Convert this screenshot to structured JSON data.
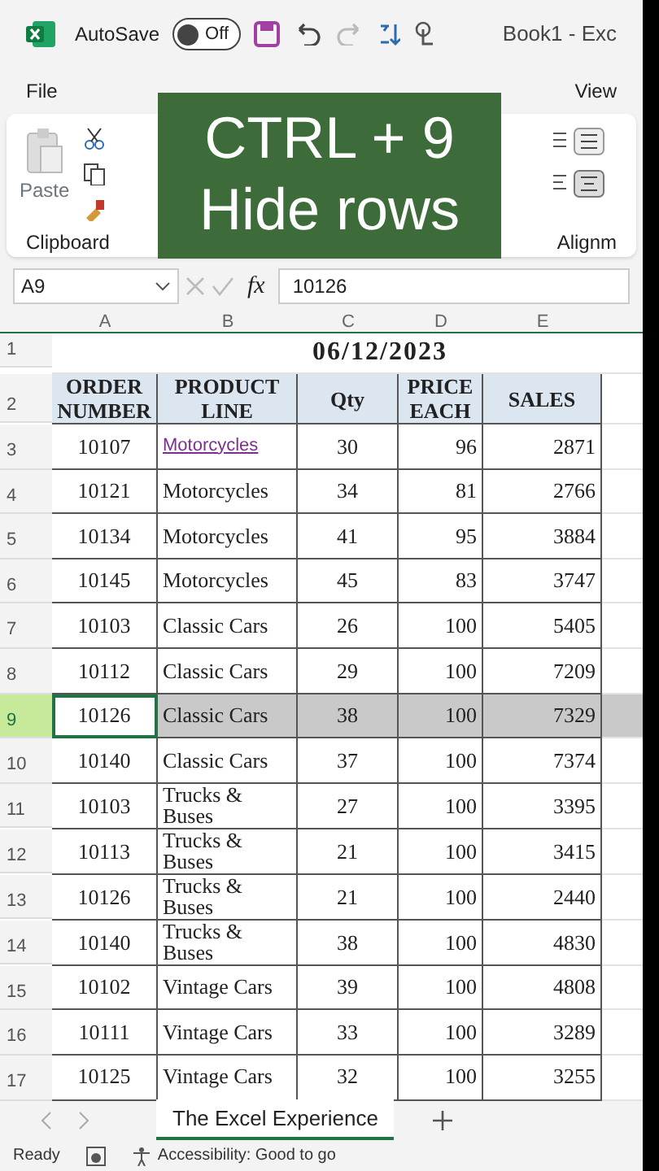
{
  "title_bar": {
    "autosave_label": "AutoSave",
    "autosave_on": false,
    "toggle_text": "Off",
    "title": "Book1 - Exc"
  },
  "ribbon_tabs": [
    {
      "label": "File"
    },
    {
      "label": "View"
    }
  ],
  "ribbon": {
    "paste_label": "Paste",
    "clipboard_label": "Clipboard",
    "alignment_label": "Alignm"
  },
  "caption": {
    "lines": [
      "CTRL + 9",
      "Hide rows"
    ]
  },
  "formula_bar": {
    "name_box": "A9",
    "fx": "fx",
    "value": "10126"
  },
  "sheet": {
    "columns": [
      "A",
      "B",
      "C",
      "D",
      "E"
    ],
    "title_row": {
      "row": "1",
      "text": "06/12/2023"
    },
    "header_row": {
      "row": "2",
      "cells": [
        "ORDER NUMBER",
        "PRODUCT LINE",
        "Qty",
        "PRICE EACH",
        "SALES"
      ]
    },
    "rows": [
      {
        "row": "3",
        "selected": false,
        "hyperlink": true,
        "cells": [
          "10107",
          "Motorcycles",
          "30",
          "96",
          "2871"
        ]
      },
      {
        "row": "4",
        "selected": false,
        "hyperlink": false,
        "cells": [
          "10121",
          "Motorcycles",
          "34",
          "81",
          "2766"
        ]
      },
      {
        "row": "5",
        "selected": false,
        "hyperlink": false,
        "cells": [
          "10134",
          "Motorcycles",
          "41",
          "95",
          "3884"
        ]
      },
      {
        "row": "6",
        "selected": false,
        "hyperlink": false,
        "cells": [
          "10145",
          "Motorcycles",
          "45",
          "83",
          "3747"
        ]
      },
      {
        "row": "7",
        "selected": false,
        "hyperlink": false,
        "cells": [
          "10103",
          "Classic Cars",
          "26",
          "100",
          "5405"
        ]
      },
      {
        "row": "8",
        "selected": false,
        "hyperlink": false,
        "cells": [
          "10112",
          "Classic Cars",
          "29",
          "100",
          "7209"
        ]
      },
      {
        "row": "9",
        "selected": true,
        "hyperlink": false,
        "cells": [
          "10126",
          "Classic Cars",
          "38",
          "100",
          "7329"
        ]
      },
      {
        "row": "10",
        "selected": false,
        "hyperlink": false,
        "cells": [
          "10140",
          "Classic Cars",
          "37",
          "100",
          "7374"
        ]
      },
      {
        "row": "11",
        "selected": false,
        "hyperlink": false,
        "cells": [
          "10103",
          "Trucks & Buses",
          "27",
          "100",
          "3395"
        ]
      },
      {
        "row": "12",
        "selected": false,
        "hyperlink": false,
        "cells": [
          "10113",
          "Trucks & Buses",
          "21",
          "100",
          "3415"
        ]
      },
      {
        "row": "13",
        "selected": false,
        "hyperlink": false,
        "cells": [
          "10126",
          "Trucks & Buses",
          "21",
          "100",
          "2440"
        ]
      },
      {
        "row": "14",
        "selected": false,
        "hyperlink": false,
        "cells": [
          "10140",
          "Trucks & Buses",
          "38",
          "100",
          "4830"
        ]
      },
      {
        "row": "15",
        "selected": false,
        "hyperlink": false,
        "cells": [
          "10102",
          "Vintage Cars",
          "39",
          "100",
          "4808"
        ]
      },
      {
        "row": "16",
        "selected": false,
        "hyperlink": false,
        "cells": [
          "10111",
          "Vintage Cars",
          "33",
          "100",
          "3289"
        ]
      },
      {
        "row": "17",
        "selected": false,
        "hyperlink": false,
        "cells": [
          "10125",
          "Vintage Cars",
          "32",
          "100",
          "3255"
        ]
      }
    ]
  },
  "sheet_tabs": [
    {
      "label": "The Excel Experience",
      "selected": true
    }
  ],
  "status_bar": {
    "mode": "Ready",
    "accessibility": "Accessibility: Good to go"
  }
}
